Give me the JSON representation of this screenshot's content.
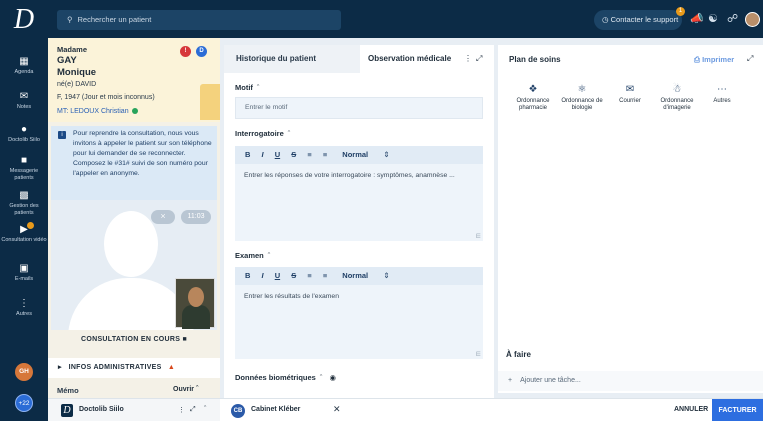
{
  "topbar": {
    "logo_letter": "D",
    "search_placeholder": "Rechercher un patient",
    "support_label": "Contacter le support",
    "support_badge": "1"
  },
  "sidebar": {
    "items": [
      {
        "label": "Agenda",
        "icon": "calendar-icon"
      },
      {
        "label": "Notes",
        "icon": "mail-icon"
      },
      {
        "label": "Doctolib Siilo",
        "icon": "chat-icon"
      },
      {
        "label": "Messagerie patients",
        "icon": "message-icon"
      },
      {
        "label": "Gestion des patients",
        "icon": "patients-icon"
      },
      {
        "label": "Consultation vidéo",
        "icon": "video-icon"
      },
      {
        "label": "E-mails",
        "icon": "email-icon"
      },
      {
        "label": "Autres",
        "icon": "more-icon"
      }
    ],
    "user_initials": "GH",
    "plus_count": "+22"
  },
  "patient": {
    "civility": "Madame",
    "last_name": "GAY",
    "first_name": "Monique",
    "birth_name": "né(e) DAVID",
    "info": "F, 1947 (Jour et mois inconnus)",
    "mt_label": "MT:",
    "mt_name": "LEDOUX Christian",
    "notice": "Pour reprendre la consultation, nous vous invitons à appeler le patient sur son téléphone pour lui demander de se reconnecter. Composez le #31# suivi de son numéro pour l'appeler en anonyme.",
    "timer": "11:03",
    "consult_status": "CONSULTATION EN COURS",
    "infos_admin": "INFOS ADMINISTRATIVES",
    "memo": "Mémo",
    "ouvrir": "Ouvrir"
  },
  "middle": {
    "tab_history": "Historique du patient",
    "tab_observation": "Observation médicale",
    "motif_label": "Motif",
    "motif_placeholder": "Entrer le motif",
    "interrogatoire_label": "Interrogatoire",
    "interrogatoire_placeholder": "Entrer les réponses de votre interrogatoire : symptômes, anamnèse ...",
    "examen_label": "Examen",
    "examen_placeholder": "Entrer les résultats de l'examen",
    "donnees_label": "Données biométriques",
    "toolbar": {
      "bold": "B",
      "italic": "I",
      "underline": "U",
      "strike": "S",
      "style": "Normal"
    }
  },
  "right": {
    "title": "Plan de soins",
    "print_label": "Imprimer",
    "actions": [
      {
        "label": "Ordonnance pharmacie",
        "icon": "pills-icon"
      },
      {
        "label": "Ordonnance de biologie",
        "icon": "flask-icon"
      },
      {
        "label": "Courrier",
        "icon": "envelope-icon"
      },
      {
        "label": "Ordonnance d'imagerie",
        "icon": "imaging-icon"
      },
      {
        "label": "Autres",
        "icon": "ellipsis-icon"
      }
    ],
    "todo_title": "À faire",
    "add_task": "Ajouter une tâche..."
  },
  "bottom": {
    "tab1_label": "Doctolib Siilo",
    "tab2_initials": "CB",
    "tab2_label": "Cabinet Kléber",
    "cancel": "ANNULER",
    "bill": "FACTURER"
  },
  "colors": {
    "navy": "#0c2b46",
    "accent_blue": "#2d6ee0",
    "warning": "#d8481c",
    "badge_orange": "#e89a1b"
  }
}
